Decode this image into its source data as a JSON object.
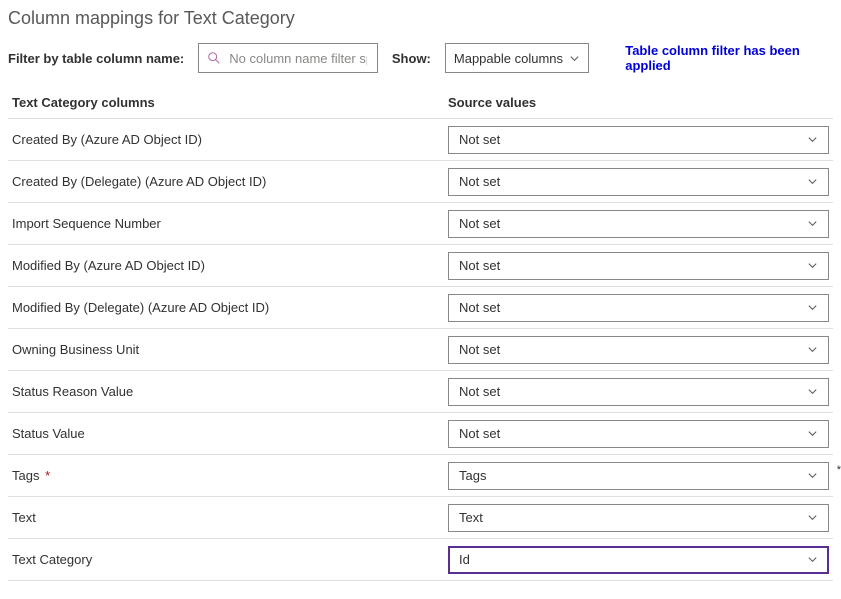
{
  "title": "Column mappings for Text Category",
  "filter": {
    "label": "Filter by table column name:",
    "placeholder": "No column name filter sp...",
    "show_label": "Show:",
    "show_value": "Mappable columns",
    "applied_msg": "Table column filter has been applied"
  },
  "headers": {
    "left": "Text Category columns",
    "right": "Source values"
  },
  "rows": [
    {
      "label": "Created By (Azure AD Object ID)",
      "value": "Not set",
      "required": false,
      "focused": false
    },
    {
      "label": "Created By (Delegate) (Azure AD Object ID)",
      "value": "Not set",
      "required": false,
      "focused": false
    },
    {
      "label": "Import Sequence Number",
      "value": "Not set",
      "required": false,
      "focused": false
    },
    {
      "label": "Modified By (Azure AD Object ID)",
      "value": "Not set",
      "required": false,
      "focused": false
    },
    {
      "label": "Modified By (Delegate) (Azure AD Object ID)",
      "value": "Not set",
      "required": false,
      "focused": false
    },
    {
      "label": "Owning Business Unit",
      "value": "Not set",
      "required": false,
      "focused": false
    },
    {
      "label": "Status Reason Value",
      "value": "Not set",
      "required": false,
      "focused": false
    },
    {
      "label": "Status Value",
      "value": "Not set",
      "required": false,
      "focused": false
    },
    {
      "label": "Tags",
      "value": "Tags",
      "required": true,
      "focused": false
    },
    {
      "label": "Text",
      "value": "Text",
      "required": false,
      "focused": false
    },
    {
      "label": "Text Category",
      "value": "Id",
      "required": false,
      "focused": true
    }
  ]
}
